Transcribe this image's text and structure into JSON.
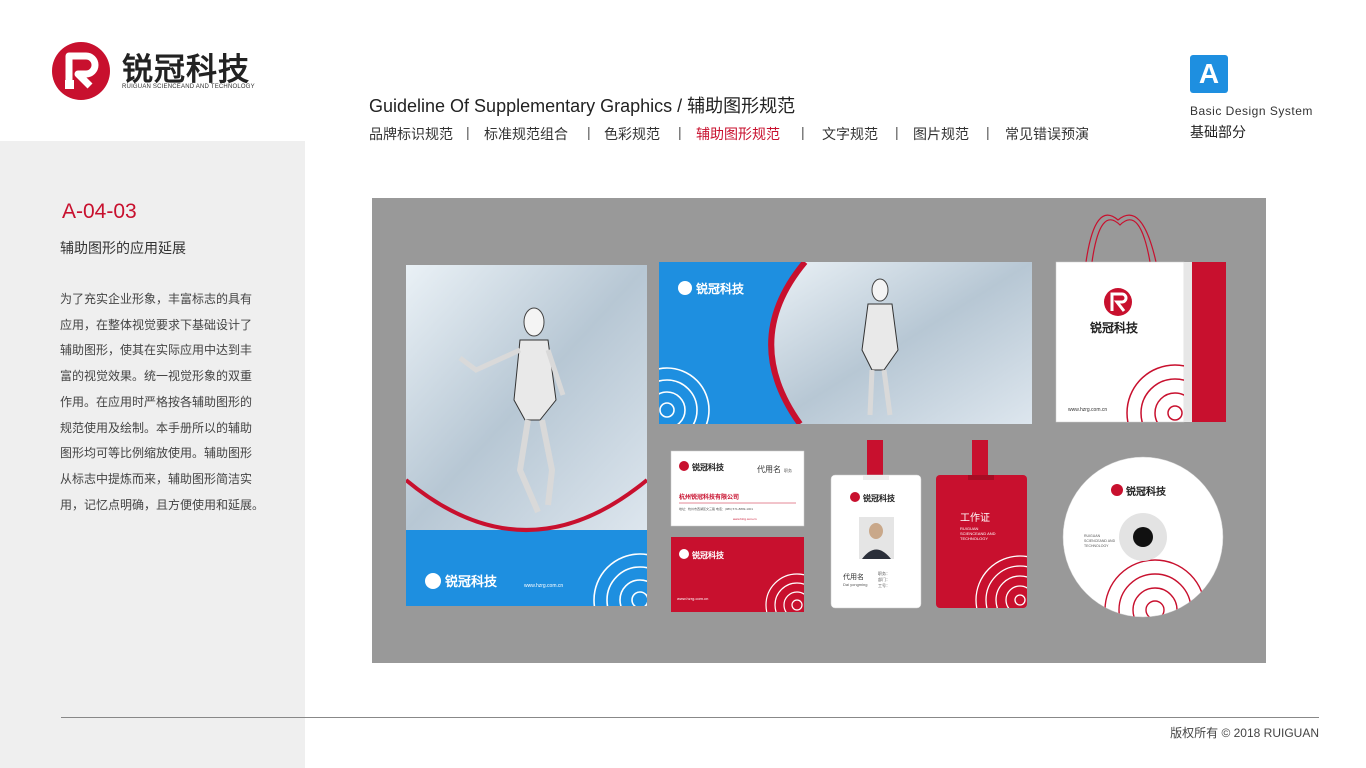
{
  "brand": {
    "name_cn": "锐冠科技",
    "name_en": "RUIGUAN SCIENCEAND AND TECHNOLOGY",
    "accent_color": "#c8102e",
    "blue_color": "#1e8fe0"
  },
  "header": {
    "title": "Guideline Of Supplementary Graphics  /  辅助图形规范",
    "nav": [
      {
        "label": "品牌标识规范",
        "active": false
      },
      {
        "label": "标准规范组合",
        "active": false
      },
      {
        "label": "色彩规范",
        "active": false
      },
      {
        "label": "辅助图形规范",
        "active": true
      },
      {
        "label": "文字规范",
        "active": false
      },
      {
        "label": "图片规范",
        "active": false
      },
      {
        "label": "常见错误预演",
        "active": false
      }
    ],
    "separator": "|"
  },
  "system_badge": {
    "letter": "A",
    "label_en": "Basic  Design  System",
    "label_cn": "基础部分"
  },
  "sidebar": {
    "code": "A-04-03",
    "subtitle": "辅助图形的应用延展",
    "description_lines": [
      "为了充实企业形象，丰富标志的具有",
      "应用，在整体视觉要求下基础设计了",
      "辅助图形，使其在实际应用中达到丰",
      "富的视觉效果。统一视觉形象的双重",
      "作用。在应用时严格按各辅助图形的",
      "规范使用及绘制。本手册所以的辅助",
      "图形均可等比例缩放使用。辅助图形",
      "从标志中提炼而来，辅助图形简洁实",
      "用，记忆点明确，且方便使用和延展。"
    ]
  },
  "mockup": {
    "website": "www.hzrg.com.cn",
    "company_full": "杭州锐冠科技有限公司",
    "card_name": "代用名",
    "card_title": "职务",
    "badge_name": "代用名",
    "badge_name_en": "Dai yongming",
    "badge_fields": [
      "职务：",
      "部门：",
      "工号："
    ],
    "work_card_title": "工作证",
    "work_card_sub": [
      "RUIGUAN",
      "SCIENCEAND AND",
      "TECHNOLOGY"
    ],
    "card_address": "地址：杭州市西湖区文三路 电话：(086) 571-8899-1001",
    "cd_text": [
      "RUIGUAN",
      "SCIENCEAND AND",
      "TECHNOLOGY"
    ]
  },
  "footer": {
    "copyright": "版权所有 ©   2018   RUIGUAN"
  }
}
